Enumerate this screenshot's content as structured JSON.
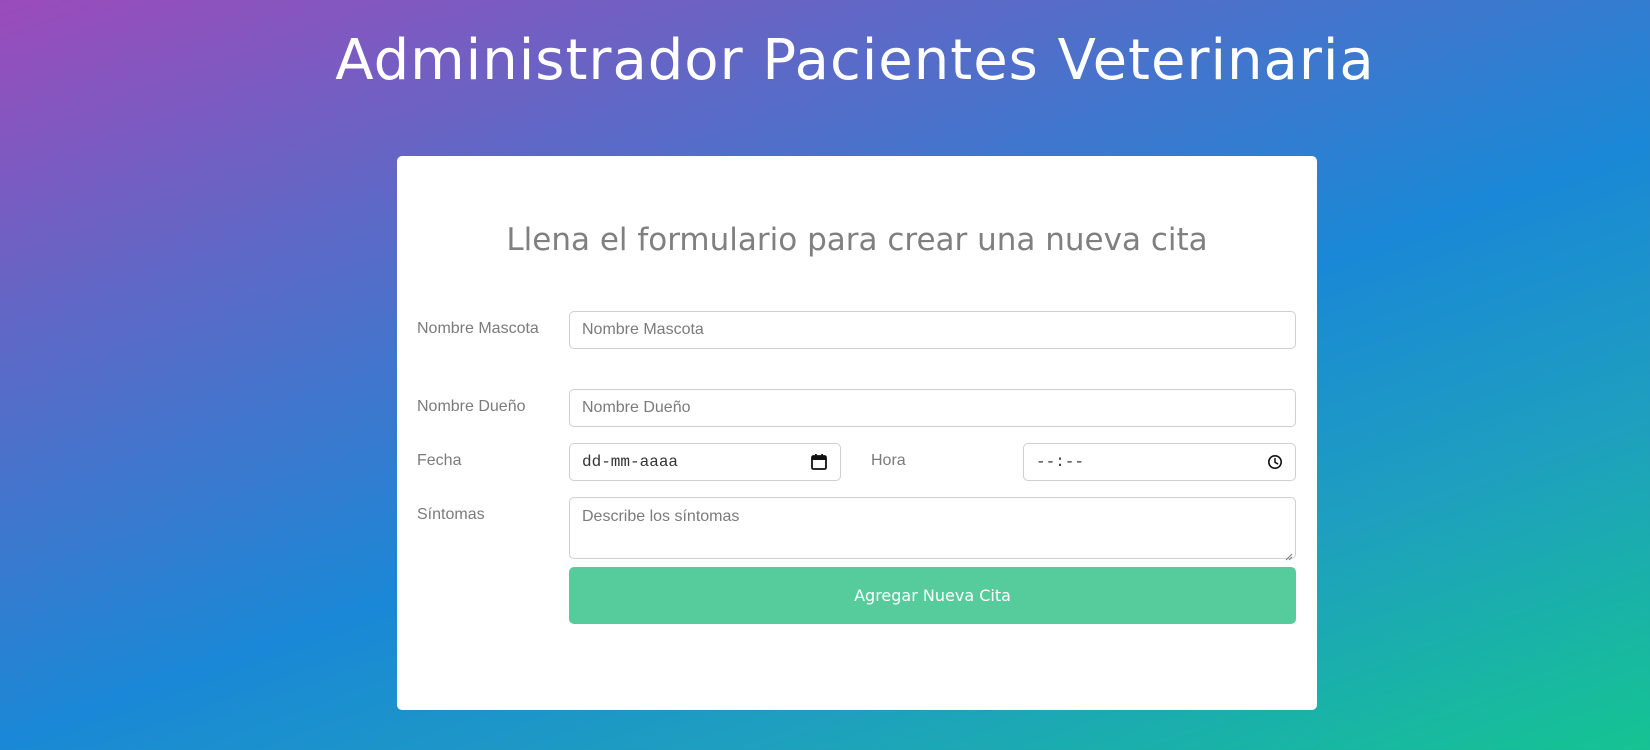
{
  "header": {
    "title": "Administrador Pacientes Veterinaria"
  },
  "form": {
    "heading": "Llena el formulario para crear una nueva cita",
    "pet_name": {
      "label": "Nombre Mascota",
      "placeholder": "Nombre Mascota",
      "value": ""
    },
    "owner_name": {
      "label": "Nombre Dueño",
      "placeholder": "Nombre Dueño",
      "value": ""
    },
    "date": {
      "label": "Fecha",
      "placeholder": "dd-mm-aaaa",
      "icon": "calendar-icon"
    },
    "time": {
      "label": "Hora",
      "placeholder": "--:--",
      "icon": "clock-icon"
    },
    "symptoms": {
      "label": "Síntomas",
      "placeholder": "Describe los síntomas",
      "value": ""
    },
    "submit_label": "Agregar Nueva Cita"
  },
  "colors": {
    "button": "#56cc9d",
    "label_text": "#7b7b7b",
    "card_background": "#ffffff"
  }
}
